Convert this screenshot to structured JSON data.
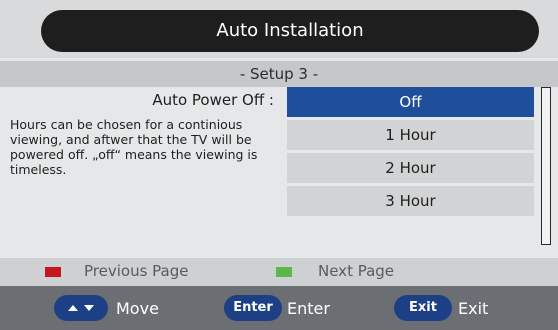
{
  "window": {
    "title": "Auto Installation"
  },
  "setup": {
    "step_title": "- Setup 3 -"
  },
  "setting": {
    "label": "Auto Power Off :",
    "description": "Hours can be chosen for a continious viewing, and aftwer that the TV will be powered off. „off“ means the viewing is timeless.",
    "options": [
      {
        "label": "Off",
        "selected": true
      },
      {
        "label": "1 Hour",
        "selected": false
      },
      {
        "label": "2 Hour",
        "selected": false
      },
      {
        "label": "3 Hour",
        "selected": false
      }
    ]
  },
  "navigation": {
    "previous": {
      "label": "Previous Page",
      "color": "#c4161c"
    },
    "next": {
      "label": "Next Page",
      "color": "#59b84a"
    }
  },
  "footer": {
    "move": {
      "key_icon": "up-down-arrows-icon",
      "label": "Move"
    },
    "enter": {
      "key": "Enter",
      "label": "Enter"
    },
    "exit": {
      "key": "Exit",
      "label": "Exit"
    }
  },
  "colors": {
    "accent": "#1f4f9a",
    "title_bg": "#1e1e1e",
    "key_pill": "#1d3f86"
  }
}
